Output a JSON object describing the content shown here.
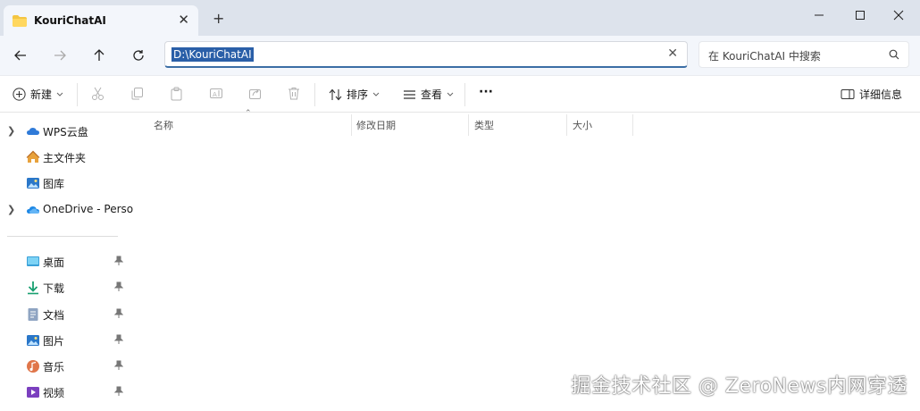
{
  "tab": {
    "title": "KouriChatAI",
    "close": "✕",
    "new_tab": "+"
  },
  "window_controls": {
    "minimize": "minimize-icon",
    "maximize": "maximize-icon",
    "close": "close-icon"
  },
  "nav_buttons": [
    "back-icon",
    "forward-icon",
    "up-icon",
    "refresh-icon"
  ],
  "address": {
    "path": "D:\\KouriChatAI",
    "clear": "✕"
  },
  "search": {
    "placeholder": "在 KouriChatAI 中搜索"
  },
  "toolbar": {
    "new_label": "新建",
    "sort_label": "排序",
    "view_label": "查看",
    "more_label": "···",
    "details_label": "详细信息",
    "icons": [
      "cut-icon",
      "copy-icon",
      "paste-icon",
      "rename-icon",
      "share-icon",
      "delete-icon"
    ]
  },
  "sidebar": {
    "items": [
      {
        "label": "WPS云盘",
        "icon": "cloud-icon",
        "expandable": true
      },
      {
        "label": "主文件夹",
        "icon": "home-icon",
        "expandable": false
      },
      {
        "label": "图库",
        "icon": "gallery-icon",
        "expandable": false
      },
      {
        "label": "OneDrive - Perso",
        "icon": "onedrive-icon",
        "expandable": true
      }
    ],
    "quick_access": [
      {
        "label": "桌面",
        "icon": "desktop-icon"
      },
      {
        "label": "下载",
        "icon": "download-icon"
      },
      {
        "label": "文档",
        "icon": "documents-icon"
      },
      {
        "label": "图片",
        "icon": "pictures-icon"
      },
      {
        "label": "音乐",
        "icon": "music-icon"
      },
      {
        "label": "视频",
        "icon": "videos-icon"
      }
    ]
  },
  "columns": [
    "名称",
    "修改日期",
    "类型",
    "大小"
  ],
  "watermark": "掘金技术社区 @ ZeroNews内网穿透"
}
